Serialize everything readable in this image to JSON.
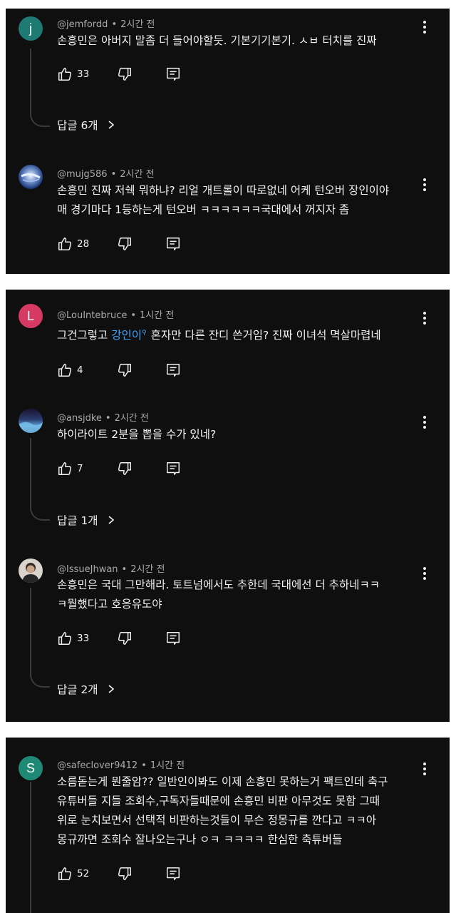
{
  "panel1": {
    "comments": [
      {
        "avatar": {
          "letter": "j",
          "color": "#1e7a73"
        },
        "handle": "@jemfordd",
        "time": "2시간 전",
        "lines": [
          "손흥민은 아버지 말좀 더 들어야할듯. 기본기기본기. ㅅㅂ 터치를 진짜"
        ],
        "likes": "33",
        "replies": "답글 6개"
      },
      {
        "avatar": {
          "image": "blue-blurred-photo"
        },
        "handle": "@mujg586",
        "time": "2시간 전",
        "lines": [
          "손흥민 진짜 저쉑 뭐하냐? 리얼 개트롤이 따로없네 어케 턴오버 장인이야",
          "매 경기마다 1등하는게 턴오버 ㅋㅋㅋㅋㅋㅋ국대에서 꺼지자 좀"
        ],
        "likes": "28"
      }
    ]
  },
  "panel2": {
    "comments": [
      {
        "avatar": {
          "letter": "L",
          "color": "#d63a62"
        },
        "handle": "@LouIntebruce",
        "time": "1시간 전",
        "text_before": "그건그렇고 ",
        "mention": "강인이",
        "text_after": "혼자만 다른 잔디 쓴거임? 진짜 이녀석 멱살마렵네",
        "likes": "4"
      },
      {
        "avatar": {
          "image": "scenery-photo"
        },
        "handle": "@ansjdke",
        "time": "2시간 전",
        "lines": [
          "하이라이트 2분을 뽑을 수가 있네?"
        ],
        "likes": "7",
        "replies": "답글 1개"
      },
      {
        "avatar": {
          "image": "person-photo"
        },
        "handle": "@IssueJhwan",
        "time": "2시간 전",
        "lines": [
          "손흥민은 국대 그만해라. 토트넘에서도 추한데 국대에선 더 추하네ㅋㅋ",
          "ㅋ뭘했다고 호응유도야"
        ],
        "likes": "33",
        "replies": "답글 2개"
      }
    ]
  },
  "panel3": {
    "comments": [
      {
        "avatar": {
          "letter": "S",
          "color": "#1e8a76"
        },
        "handle": "@safeclover9412",
        "time": "1시간 전",
        "lines": [
          "소름돋는게 뭔줄암?? 일반인이봐도 이제 손흥민 못하는거 팩트인데 축구",
          "유튜버들 지들 조회수,구독자들때문에 손흥민 비판 아무것도 못함 그때",
          "위로 눈치보면서 선택적 비판하는것들이 무슨 정몽규를 깐다고 ㅋㅋ아",
          "몽규까면 조회수 잘나오는구나 ㅇㅋ ㅋㅋㅋㅋ 한심한 축튜버들"
        ],
        "likes": "52"
      }
    ]
  },
  "colors": {
    "panel_bg": "#0f0f0f",
    "text": "#f1f1f1",
    "meta": "#aaaaaa",
    "mention": "#3ea6ff"
  },
  "icons": [
    "thumbs-up-icon",
    "thumbs-down-icon",
    "reply-comment-icon",
    "more-vert-icon",
    "chevron-right-icon"
  ]
}
